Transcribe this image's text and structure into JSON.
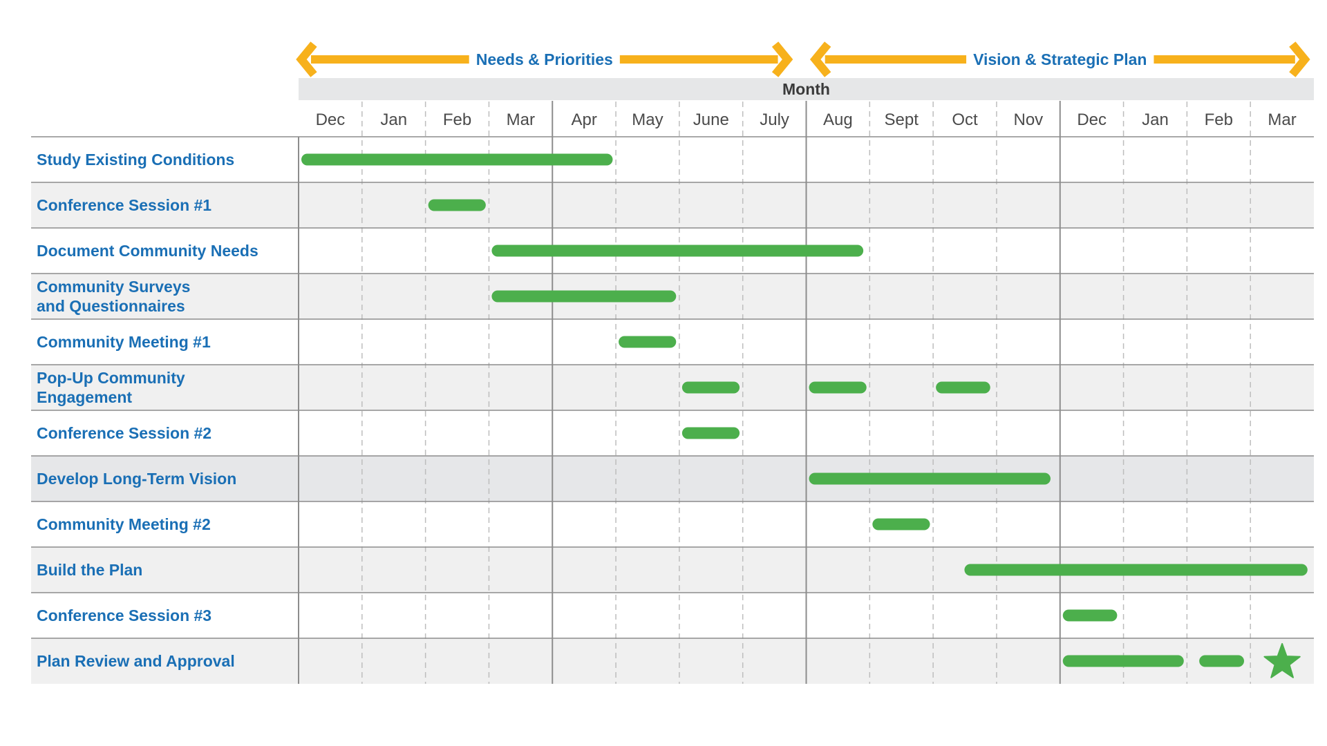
{
  "chart_data": {
    "type": "gantt",
    "title": "",
    "xlabel": "Month",
    "ylabel": "",
    "grid": true,
    "months": [
      "Dec",
      "Jan",
      "Feb",
      "Mar",
      "Apr",
      "May",
      "June",
      "July",
      "Aug",
      "Sept",
      "Oct",
      "Nov",
      "Dec",
      "Jan",
      "Feb",
      "Mar"
    ],
    "x_range_months": [
      0,
      16
    ],
    "major_dividers_at_month": [
      4,
      8,
      12
    ],
    "phases": [
      {
        "name": "Needs & Priorities",
        "start": 0,
        "end": 7.75
      },
      {
        "name": "Vision & Strategic Plan",
        "start": 8.1,
        "end": 15.9
      }
    ],
    "tasks": [
      {
        "name": "Study Existing Conditions",
        "lines": [
          "Study Existing Conditions"
        ],
        "segments": [
          [
            0,
            4.95
          ]
        ]
      },
      {
        "name": "Conference Session #1",
        "lines": [
          "Conference Session #1"
        ],
        "segments": [
          [
            2,
            2.95
          ]
        ]
      },
      {
        "name": "Document Community Needs",
        "lines": [
          "Document Community Needs"
        ],
        "segments": [
          [
            3,
            8.9
          ]
        ]
      },
      {
        "name": "Community Surveys and Questionnaires",
        "lines": [
          "Community Surveys",
          "and Questionnaires"
        ],
        "segments": [
          [
            3,
            5.95
          ]
        ]
      },
      {
        "name": "Community Meeting #1",
        "lines": [
          "Community Meeting #1"
        ],
        "segments": [
          [
            5,
            5.95
          ]
        ]
      },
      {
        "name": "Pop-Up Community Engagement",
        "lines": [
          "Pop-Up Community",
          "Engagement"
        ],
        "segments": [
          [
            6,
            6.95
          ],
          [
            8,
            8.95
          ],
          [
            10,
            10.9
          ]
        ]
      },
      {
        "name": "Conference Session #2",
        "lines": [
          "Conference Session #2"
        ],
        "segments": [
          [
            6,
            6.95
          ]
        ]
      },
      {
        "name": "Develop Long-Term Vision",
        "lines": [
          "Develop Long-Term Vision"
        ],
        "segments": [
          [
            8,
            11.85
          ]
        ]
      },
      {
        "name": "Community Meeting #2",
        "lines": [
          "Community Meeting #2"
        ],
        "segments": [
          [
            9,
            9.95
          ]
        ]
      },
      {
        "name": "Build the Plan",
        "lines": [
          "Build the Plan"
        ],
        "segments": [
          [
            10.45,
            15.9
          ]
        ]
      },
      {
        "name": "Conference Session #3",
        "lines": [
          "Conference Session #3"
        ],
        "segments": [
          [
            12,
            12.9
          ]
        ]
      },
      {
        "name": "Plan Review and Approval",
        "lines": [
          "Plan Review and Approval"
        ],
        "segments": [
          [
            12,
            13.95
          ],
          [
            14.15,
            14.9
          ]
        ],
        "milestone": 15.5
      }
    ],
    "colors": {
      "bar": "#4caf4c",
      "phase_arrow": "#f7b11c",
      "label_text": "#1a6fb5",
      "month_text": "#4a4a4a",
      "header_band": "#e6e7e8",
      "row_shade": "#f0f0f0",
      "row_shade_dark": "#e6e7e9",
      "grid_line": "#8c8c8c",
      "dashed_line": "#bdbdbd"
    },
    "shaded_rows": [
      1,
      3,
      5,
      7,
      9,
      11
    ],
    "dark_shaded_rows": [
      7
    ]
  }
}
